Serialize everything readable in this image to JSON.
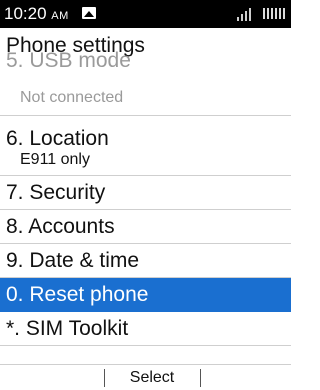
{
  "status_bar": {
    "time": "10:20",
    "ampm": "AM",
    "icons": [
      "image-notification-icon",
      "signal-icon",
      "battery-icon"
    ]
  },
  "header": {
    "title": "Phone settings"
  },
  "menu": {
    "items": [
      {
        "label": "5. USB mode",
        "sublabel": "Not connected"
      },
      {
        "label": "6. Location",
        "sublabel": "E911 only"
      },
      {
        "label": "7. Security"
      },
      {
        "label": "8. Accounts"
      },
      {
        "label": "9. Date & time"
      },
      {
        "label": "0. Reset phone",
        "selected": true
      },
      {
        "label": "*. SIM Toolkit"
      }
    ]
  },
  "softkeys": {
    "left": "",
    "center": "Select",
    "right": ""
  },
  "colors": {
    "selection": "#1a6fd0",
    "status_bar": "#000000"
  }
}
